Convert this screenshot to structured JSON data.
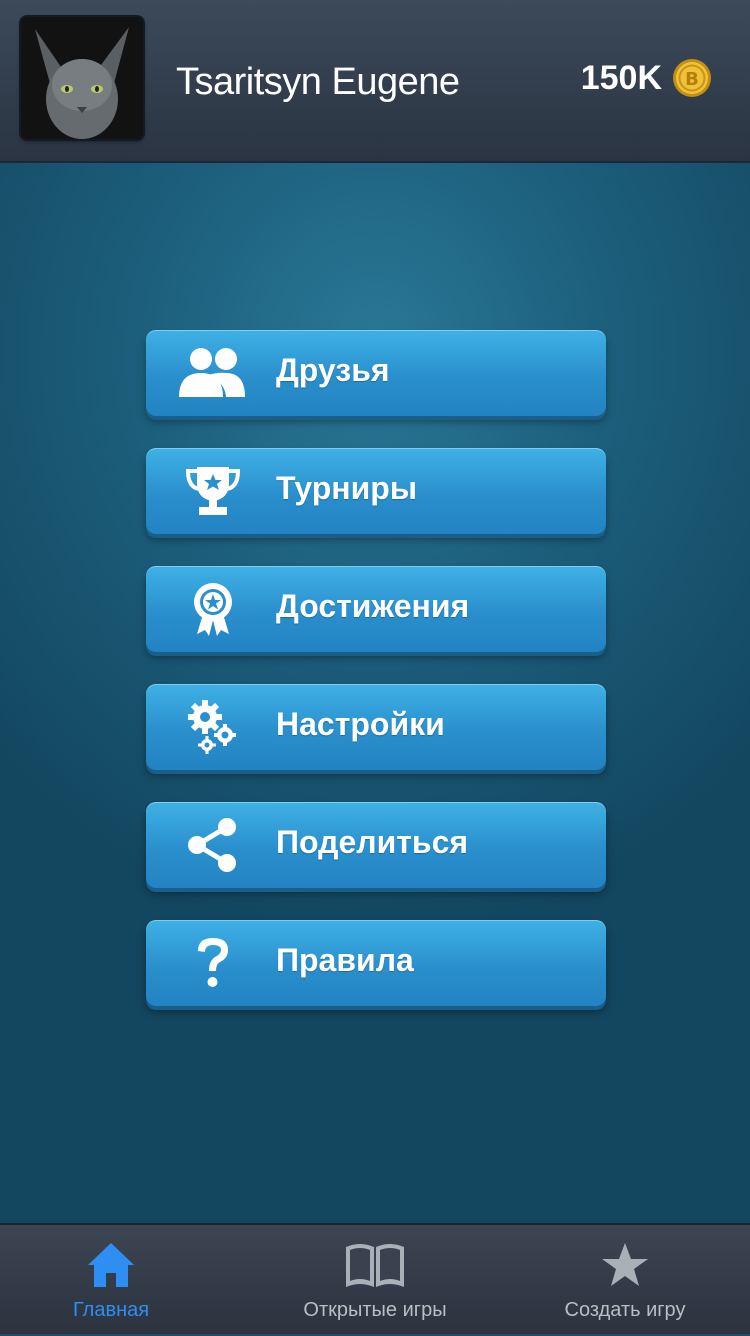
{
  "header": {
    "username": "Tsaritsyn Eugene",
    "coins": "150K"
  },
  "menu": {
    "items": [
      {
        "label": "Друзья",
        "icon": "friends-icon"
      },
      {
        "label": "Турниры",
        "icon": "trophy-icon"
      },
      {
        "label": "Достижения",
        "icon": "medal-icon"
      },
      {
        "label": "Настройки",
        "icon": "gears-icon"
      },
      {
        "label": "Поделиться",
        "icon": "share-icon"
      },
      {
        "label": "Правила",
        "icon": "question-icon"
      }
    ]
  },
  "tabbar": {
    "tabs": [
      {
        "label": "Главная",
        "icon": "home-icon",
        "active": true
      },
      {
        "label": "Открытые игры",
        "icon": "book-icon",
        "active": false
      },
      {
        "label": "Создать игру",
        "icon": "star-icon",
        "active": false
      }
    ]
  },
  "colors": {
    "accent": "#2f8ef2",
    "button": "#2a8fcd",
    "coin": "#e6b422"
  }
}
